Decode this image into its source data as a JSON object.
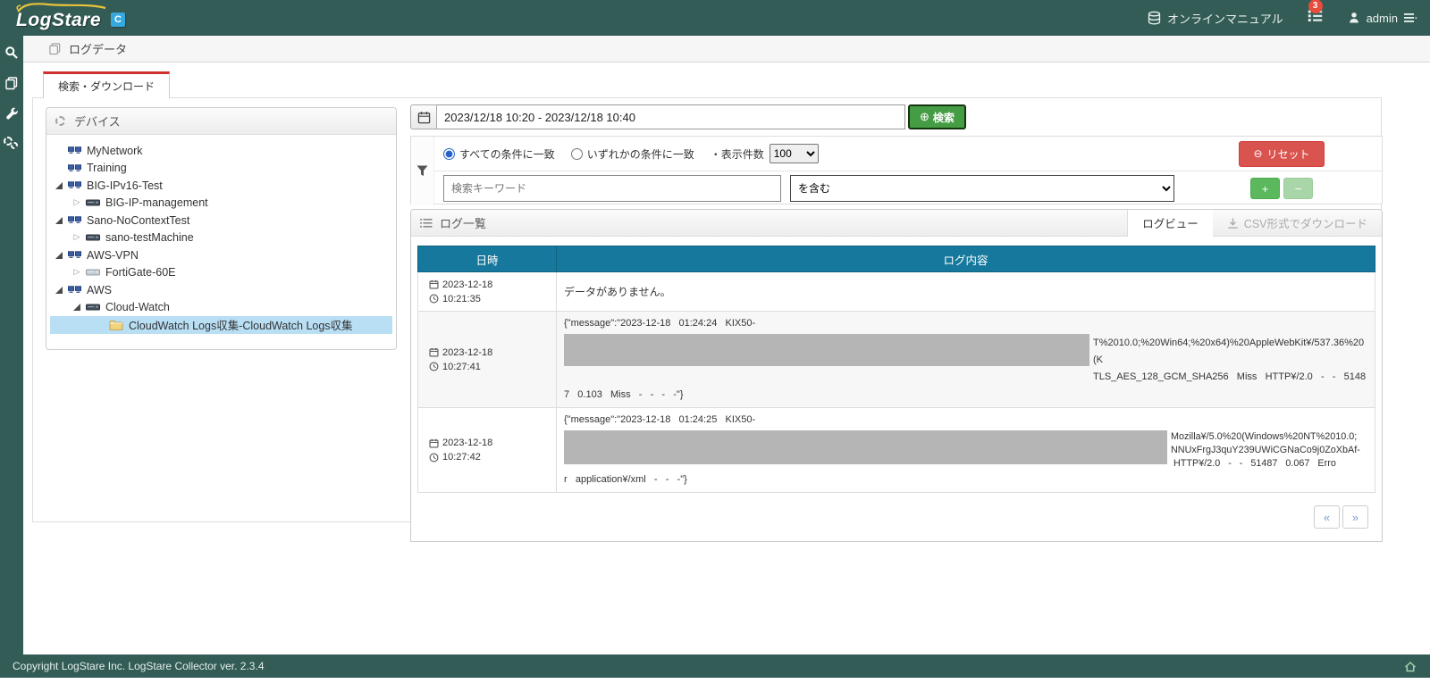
{
  "topbar": {
    "brand": "LogStare",
    "brand_badge": "C",
    "manual_label": "オンラインマニュアル",
    "notification_count": "3",
    "user_name": "admin"
  },
  "breadcrumb": {
    "title": "ログデータ"
  },
  "tab": {
    "label": "検索・ダウンロード"
  },
  "device_panel": {
    "title": "デバイス",
    "tree": [
      {
        "label": "MyNetwork"
      },
      {
        "label": "Training"
      },
      {
        "label": "BIG-IPv16-Test"
      },
      {
        "label": "BIG-IP-management"
      },
      {
        "label": "Sano-NoContextTest"
      },
      {
        "label": "sano-testMachine"
      },
      {
        "label": "AWS-VPN"
      },
      {
        "label": "FortiGate-60E"
      },
      {
        "label": "AWS"
      },
      {
        "label": "Cloud-Watch"
      },
      {
        "label": "CloudWatch Logs収集-CloudWatch Logs収集"
      }
    ]
  },
  "search": {
    "date_range": "2023/12/18 10:20 - 2023/12/18 10:40",
    "search_button": "検索",
    "search_glyph": "⊕",
    "match_all": "すべての条件に一致",
    "match_any": "いずれかの条件に一致",
    "display_count_label": "・表示件数",
    "display_count_value": "100",
    "keyword_placeholder": "検索キーワード",
    "condition_value": "を含む",
    "reset_button": "リセット",
    "reset_glyph": "⊖",
    "add_button": "+",
    "remove_button": "−"
  },
  "log_panel": {
    "title": "ログ一覧",
    "tab_logview": "ログビュー",
    "tab_csv": "CSV形式でダウンロード",
    "col_datetime": "日時",
    "col_content": "ログ内容",
    "rows": [
      {
        "date": "2023-12-18",
        "time": "10:21:35",
        "message": "データがありません。"
      },
      {
        "date": "2023-12-18",
        "time": "10:27:41",
        "line1": "{\"message\":\"2023-12-18   01:24:24   KIX50-",
        "right_lines": [
          "T%2010.0;%20Win64;%20x64)%20AppleWebKit¥/537.36%20(K",
          "TLS_AES_128_GCM_SHA256   Miss   HTTP¥/2.0   -   -   5148"
        ],
        "bottom": "7   0.103   Miss   -   -   -   -\"}"
      },
      {
        "date": "2023-12-18",
        "time": "10:27:42",
        "line1": "{\"message\":\"2023-12-18   01:24:25   KIX50-",
        "right_lines": [
          "Mozilla¥/5.0%20(Windows%20NT%2010.0;",
          "NNUxFrgJ3quY239UWiCGNaCo9j0ZoXbAf-",
          " HTTP¥/2.0   -   -   51487   0.067   Erro"
        ],
        "bottom": "r   application¥/xml   -   -   -\"}"
      }
    ],
    "pagination": {
      "prev": "«",
      "next": "»"
    }
  },
  "footer": {
    "copyright": "Copyright LogStare Inc. LogStare Collector ver. 2.3.4"
  }
}
